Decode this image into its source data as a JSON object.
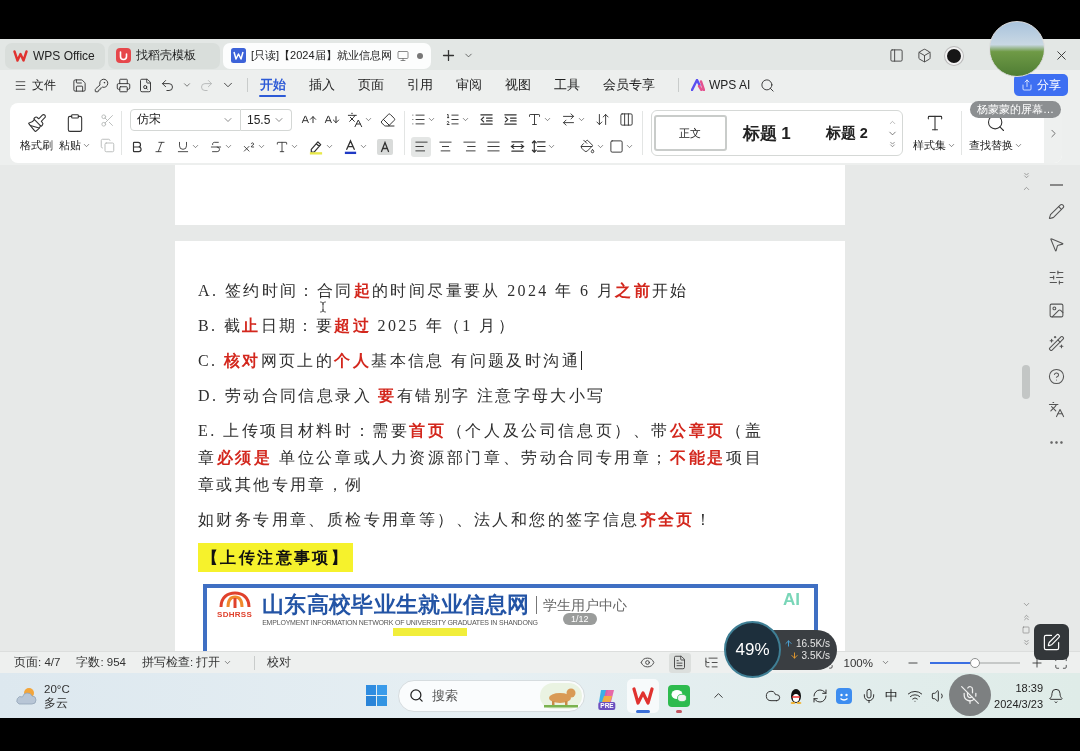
{
  "tabs": [
    {
      "kind": "home",
      "label": "WPS Office",
      "selected": false
    },
    {
      "kind": "template",
      "label": "找稻壳模板",
      "selected": false
    },
    {
      "kind": "document",
      "label": "[只读]【2024届】就业信息网",
      "selected": true
    }
  ],
  "menu": {
    "file": "文件",
    "quick_access": [
      {
        "kind": "save",
        "disabled": false
      },
      {
        "kind": "key",
        "disabled": false
      },
      {
        "kind": "print",
        "disabled": false
      },
      {
        "kind": "preview",
        "disabled": false
      },
      {
        "kind": "undo",
        "disabled": false
      },
      {
        "kind": "redo",
        "disabled": true
      }
    ],
    "tabs": [
      {
        "label": "开始",
        "selected": true
      },
      {
        "label": "插入",
        "selected": false
      },
      {
        "label": "页面",
        "selected": false
      },
      {
        "label": "引用",
        "selected": false
      },
      {
        "label": "审阅",
        "selected": false
      },
      {
        "label": "视图",
        "selected": false
      },
      {
        "label": "工具",
        "selected": false
      },
      {
        "label": "会员专享",
        "selected": false
      }
    ],
    "ai": "WPS AI",
    "share": "分享"
  },
  "screen_share": {
    "tooltip": "杨蒙蒙的屏幕…",
    "mic_muted": true
  },
  "ribbon": {
    "format_painter": "格式刷",
    "paste": "粘贴",
    "clipboard_actions": [
      {
        "kind": "cut",
        "disabled": true
      },
      {
        "kind": "copy",
        "disabled": true
      }
    ],
    "font": "仿宋",
    "font_size": "15.5",
    "alignment": [
      {
        "kind": "left",
        "selected": true
      },
      {
        "kind": "center",
        "selected": false
      },
      {
        "kind": "right",
        "selected": false
      },
      {
        "kind": "justify",
        "selected": false
      },
      {
        "kind": "distributed",
        "selected": false
      }
    ],
    "styles": [
      {
        "label": "正文",
        "selected": true
      },
      {
        "label": "标题 1",
        "selected": false
      },
      {
        "label": "标题 2",
        "selected": false
      }
    ],
    "style_set": "样式集",
    "find_replace": "查找替换"
  },
  "document": {
    "paragraphs": [
      {
        "kind": "item",
        "text": "A. 签约时间：合同**起**的时间尽量要从 2024 年 6 月**之前**开始",
        "caret": false
      },
      {
        "kind": "item",
        "text": "B. 截**止**日期：要**超过** 2025 年（1 月）",
        "caret": false
      },
      {
        "kind": "item",
        "text": "C. **核对**网页上的**个人**基本信息 有问题及时沟通",
        "caret": true
      },
      {
        "kind": "item",
        "text": "D. 劳动合同信息录入 **要**有错别字 注意字母大小写",
        "caret": false
      },
      {
        "kind": "item",
        "text": "E. 上传项目材料时：需要**首页**（个人及公司信息页）、带**公章页**（盖章**必须是** 单位公章或人力资源部门章、劳动合同专用章；**不能是**项目章或其他专用章，例",
        "caret": false
      },
      {
        "kind": "continuation",
        "text": "如财务专用章、质检专用章等）、法人和您的签字信息**齐全页**！",
        "caret": false
      },
      {
        "kind": "heading",
        "text": "【上传注意事项】",
        "caret": false
      }
    ],
    "image": {
      "logo": "SDHRSS",
      "title": "山东高校毕业生就业信息网",
      "subtitle": "学生用户中心",
      "tagline": "EMPLOYMENT INFORMATION NETWORK OF UNIVERSITY GRADUATES IN SHANDONG",
      "badge": "AI",
      "counter": "1/12"
    }
  },
  "status_bar": {
    "page": "页面: 4/7",
    "words": "字数: 954",
    "spell_check": "拼写检查: 打开",
    "proofread": "校对",
    "views": [
      {
        "kind": "reading",
        "selected": false
      },
      {
        "kind": "page",
        "selected": true
      },
      {
        "kind": "outline",
        "selected": false
      }
    ],
    "zoom": "100%",
    "zoom_slider": {
      "level": 0.5
    }
  },
  "net_monitor": {
    "usage": "49%",
    "upload": "16.5K/s",
    "download": "3.5K/s"
  },
  "taskbar": {
    "weather": {
      "temperature": "20°C",
      "condition": "多云"
    },
    "search": {
      "placeholder": "搜索"
    },
    "apps": [
      {
        "kind": "copilot",
        "badge": "PRE",
        "open": false,
        "active": false
      },
      {
        "kind": "office",
        "open": true,
        "active": true
      },
      {
        "kind": "chat",
        "open": true,
        "active": false
      }
    ],
    "input_method": "中",
    "time": "18:39",
    "date": "2024/3/23"
  }
}
